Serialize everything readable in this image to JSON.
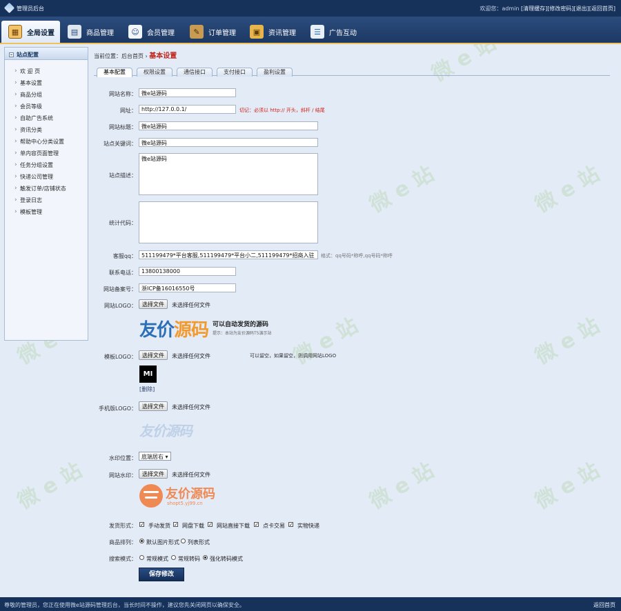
{
  "header": {
    "app_title": "管理员后台",
    "welcome": "欢迎您：",
    "user": "admin",
    "links": [
      "[清理缓存]",
      "[修改密码]",
      "[退出]",
      "[返回首页]"
    ]
  },
  "nav": {
    "tabs": [
      {
        "label": "全局设置",
        "icon": "settings-icon"
      },
      {
        "label": "商品管理",
        "icon": "goods-icon"
      },
      {
        "label": "会员管理",
        "icon": "members-icon"
      },
      {
        "label": "订单管理",
        "icon": "orders-icon"
      },
      {
        "label": "资讯管理",
        "icon": "news-icon"
      },
      {
        "label": "广告互动",
        "icon": "ads-icon"
      }
    ]
  },
  "sidebar": {
    "title": "站点配置",
    "items": [
      "欢 迎 页",
      "基本设置",
      "商品分组",
      "会员等级",
      "自助广告系统",
      "资讯分类",
      "帮助中心分类设置",
      "单内容页面管理",
      "任务分组设置",
      "快递公司管理",
      "触发订单/店铺状态",
      "登录日志",
      "模板管理"
    ]
  },
  "breadcrumb": {
    "prefix": "当前位置：",
    "home": "后台首页",
    "sep": "›",
    "current": "基本设置"
  },
  "tabs": [
    "基本配置",
    "权限设置",
    "通信接口",
    "支付接口",
    "盈利设置"
  ],
  "form": {
    "site_name_label": "网站名称：",
    "site_name": "微e站源码",
    "url_label": "网址：",
    "url": "http://127.0.0.1/",
    "url_hint": "切记：必须以 http:// 开头，斜杆 / 结尾",
    "site_title_label": "网站标题：",
    "site_title": "微e站源码",
    "keywords_label": "站点关键词：",
    "keywords": "微e站源码",
    "desc_label": "站点描述：",
    "desc": "微e站源码",
    "stats_label": "统计代码：",
    "stats": "",
    "qq_label": "客服qq：",
    "qq": "511199479*平台客服,511199479*平台小二,511199479*招商入驻",
    "qq_hint": "格式：qq号码*称呼,qq号码*称呼",
    "phone_label": "联系电话：",
    "phone": "13800138000",
    "icp_label": "网站备案号：",
    "icp": "浙ICP备16016550号",
    "logo_label": "网站LOGO：",
    "file_btn": "选择文件",
    "file_none": "未选择任何文件",
    "tpl_logo_label": "模板LOGO：",
    "tpl_logo_hint": "可以留空，如果留空，则调用网站LOGO",
    "delete_link": "[删除]",
    "mobile_logo_label": "手机版LOGO：",
    "watermark_pos_label": "水印位置：",
    "watermark_pos": "底端居右 ▾",
    "watermark_label": "网站水印：",
    "ship_label": "发货形式：",
    "ship_options": [
      "手动发货",
      "网盘下载",
      "网站直接下载",
      "点卡交易",
      "实物快递"
    ],
    "sort_label": "商品排列：",
    "sort_options": [
      "默认图片形式",
      "列表形式"
    ],
    "search_label": "搜索模式：",
    "search_options": [
      "常规模式",
      "常规转码",
      "强化转码模式"
    ],
    "save": "保存修改"
  },
  "logos": {
    "site_logo_text_a": "友价",
    "site_logo_text_b": "源码",
    "site_slogan": "可以自动发货的源码",
    "site_sub": "提示：本站为友价源码T5演示站",
    "tpl_logo": "MI",
    "mobile_logo": "友价源码",
    "watermark_text": "友价源码",
    "watermark_url": "shopt5.yj99.cn"
  },
  "watermark_bg": "微 e 站",
  "footer": {
    "text": "尊敬的管理员，您正在使用微e站源码管理后台，当长时间不操作，建议您先关闭网页以确保安全。",
    "home": "返回首页"
  },
  "colors": {
    "accent": "#16315a",
    "hint_red": "#d2231b",
    "save_btn": "#1d3864"
  }
}
